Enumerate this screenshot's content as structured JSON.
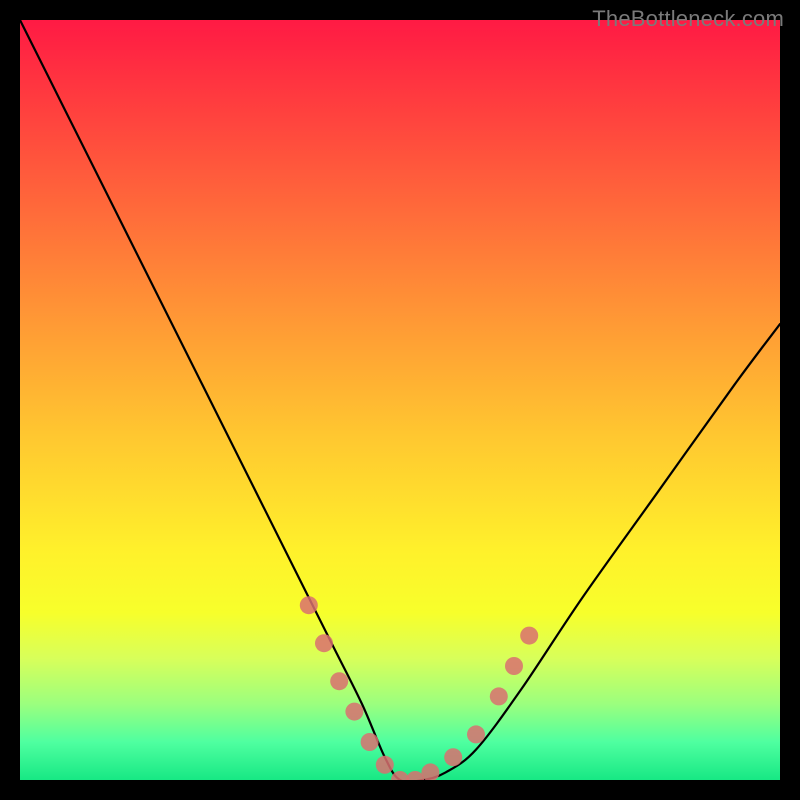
{
  "watermark": "TheBottleneck.com",
  "chart_data": {
    "type": "line",
    "title": "",
    "xlabel": "",
    "ylabel": "",
    "xlim": [
      0,
      100
    ],
    "ylim": [
      0,
      100
    ],
    "note": "No ticks or gridlines are visible; values below are percentages of the plotting area estimated from the curve geometry. Background vertical gradient runs red (top) → yellow (mid) → green (bottom).",
    "series": [
      {
        "name": "bottleneck-curve",
        "x": [
          0,
          6,
          12,
          18,
          24,
          30,
          36,
          41,
          45,
          48,
          50,
          53,
          56,
          60,
          66,
          74,
          84,
          94,
          100
        ],
        "y": [
          100,
          88,
          76,
          64,
          52,
          40,
          28,
          18,
          10,
          3,
          0,
          0,
          1,
          4,
          12,
          24,
          38,
          52,
          60
        ]
      }
    ],
    "markers": {
      "name": "highlight-beads",
      "color": "#d97070",
      "points_xy": [
        [
          38,
          23
        ],
        [
          40,
          18
        ],
        [
          42,
          13
        ],
        [
          44,
          9
        ],
        [
          46,
          5
        ],
        [
          48,
          2
        ],
        [
          50,
          0
        ],
        [
          52,
          0
        ],
        [
          54,
          1
        ],
        [
          57,
          3
        ],
        [
          60,
          6
        ],
        [
          63,
          11
        ],
        [
          65,
          15
        ],
        [
          67,
          19
        ]
      ]
    },
    "gradient_stops": [
      {
        "pos": 0.0,
        "color": "#ff1a44"
      },
      {
        "pos": 0.4,
        "color": "#ff9a35"
      },
      {
        "pos": 0.7,
        "color": "#fff12b"
      },
      {
        "pos": 1.0,
        "color": "#17e884"
      }
    ]
  }
}
